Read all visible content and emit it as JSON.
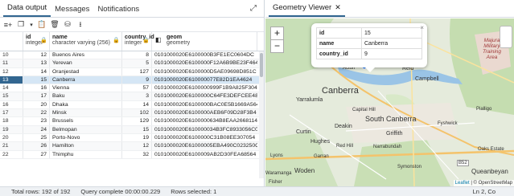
{
  "left_tabs": [
    "Data output",
    "Messages",
    "Notifications"
  ],
  "right_tab": {
    "label": "Geometry Viewer",
    "close": "✕"
  },
  "columns": [
    {
      "name": "id",
      "type": "integer"
    },
    {
      "name": "name",
      "type": "character varying (256)"
    },
    {
      "name": "country_id",
      "type": "integer"
    },
    {
      "name": "geom",
      "type": "geometry"
    }
  ],
  "rows": [
    {
      "rn": "10",
      "id": "12",
      "name": "Buenos Aires",
      "cid": "8",
      "geom": "0101000020E6100000B3FE1EC0604DC"
    },
    {
      "rn": "11",
      "id": "13",
      "name": "Yerevan",
      "cid": "5",
      "geom": "0101000020E6100000F12A6B9BE23F464"
    },
    {
      "rn": "12",
      "id": "14",
      "name": "Oranjestad",
      "cid": "127",
      "geom": "0101000020E6100000D5AE09698D851C"
    },
    {
      "rn": "13",
      "id": "15",
      "name": "Canberra",
      "cid": "9",
      "geom": "0101000020E610000077E82D1EA4624"
    },
    {
      "rn": "14",
      "id": "16",
      "name": "Vienna",
      "cid": "57",
      "geom": "0101000020E6100000999F1B9A825F304"
    },
    {
      "rn": "15",
      "id": "17",
      "name": "Baku",
      "cid": "3",
      "geom": "0101000020E6100000C64FE3DEFCEE484"
    },
    {
      "rn": "16",
      "id": "20",
      "name": "Dhaka",
      "cid": "14",
      "geom": "0101000020E6100000BAC0E5B1669A564"
    },
    {
      "rn": "17",
      "id": "22",
      "name": "Minsk",
      "cid": "102",
      "geom": "0101000020E6100000AEB6F09D28F3B4"
    },
    {
      "rn": "18",
      "id": "23",
      "name": "Brussels",
      "cid": "129",
      "geom": "0101000020E6100000634B8EAA26681144"
    },
    {
      "rn": "19",
      "id": "24",
      "name": "Belmopan",
      "cid": "15",
      "geom": "0101000020E610000034B3FC8933056C0"
    },
    {
      "rn": "20",
      "id": "25",
      "name": "Porto-Novo",
      "cid": "19",
      "geom": "0101000020E6100000C31B08EE307054"
    },
    {
      "rn": "21",
      "id": "26",
      "name": "Hamilton",
      "cid": "12",
      "geom": "0101000020E61000005EBA490C023250C"
    },
    {
      "rn": "22",
      "id": "27",
      "name": "Thimphu",
      "cid": "32",
      "geom": "0101000020E6100009AB2D30FEA68564"
    }
  ],
  "selected_row": "13",
  "popup": {
    "rows": [
      {
        "key": "id",
        "value": "15"
      },
      {
        "key": "name",
        "value": "Canberra"
      },
      {
        "key": "country_id",
        "value": "9"
      }
    ]
  },
  "map_labels": {
    "canberra": "Canberra",
    "south_canberra": "South Canberra",
    "yarralumla": "Yarralumla",
    "deakin": "Deakin",
    "griffith": "Griffith",
    "capital_hill": "Capital Hill",
    "reid": "Reid",
    "campbell": "Campbell",
    "acton": "Acton",
    "hughes": "Hughes",
    "red_hill": "Red Hill",
    "narrabundah": "Narrabundah",
    "curtin": "Curtin",
    "garran": "Garran",
    "lyons": "Lyons",
    "fisher": "Fisher",
    "woden": "Woden",
    "waramanga": "Waramanga",
    "symonston": "Symonston",
    "queanbeyan": "Queanbeyan",
    "fyshwick": "Fyshwick",
    "oaks_estate": "Oaks Estate",
    "majura": "Majura\nMilitary\nTraining\nArea",
    "b52": "B52",
    "pialligo": "Pialligo"
  },
  "attribution": {
    "leaflet": "Leaflet",
    "sep": " | © OpenStreetMap"
  },
  "status": {
    "total_rows": "Total rows: 192 of 192",
    "query": "Query complete 00:00:00.229",
    "selected": "Rows selected: 1",
    "position": "Ln 2, Co"
  },
  "colors": {
    "accent": "#326690",
    "selected_row": "#d5e6f5"
  }
}
